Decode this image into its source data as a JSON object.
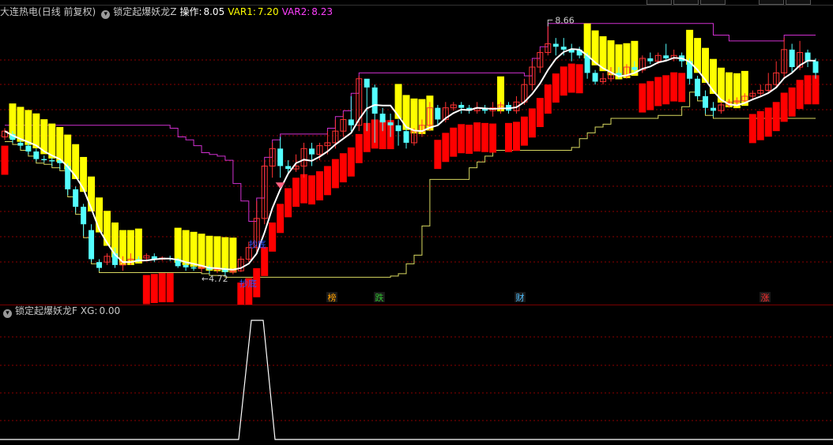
{
  "main_header": {
    "stock_name": "大连热电",
    "period": "(日线 前复权)",
    "indicator_name": "锁定起爆妖龙Z",
    "op_label": "操作:",
    "op_value": "8.05",
    "var1_label": "VAR1:",
    "var1_value": "7.20",
    "var2_label": "VAR2:",
    "var2_value": "8.23"
  },
  "sub_header": {
    "indicator_name": "锁定起爆妖龙F",
    "xg_label": "XG:",
    "xg_value": "0.00"
  },
  "colors": {
    "background": "#000000",
    "up_candle": "#ff3232",
    "down_candle": "#54ffff",
    "yellow_band": "#ffff00",
    "red_band": "#ff0000",
    "ma_line": "#ffffff",
    "upper_line": "#d030d0",
    "lower_line": "#d8d860",
    "title_text": "#c8c8c8",
    "op_color": "#ffffff",
    "var1_color": "#ffff00",
    "var2_color": "#ff40ff",
    "dotted_grid": "#8b0000"
  },
  "annotations": {
    "high_price": "8.66",
    "low_price": "4.72",
    "chaodi_label": "抄底",
    "bottom_markers": [
      {
        "text": "榜",
        "color": "#ffa000"
      },
      {
        "text": "跌",
        "color": "#30c030"
      },
      {
        "text": "财",
        "color": "#50c0ff"
      },
      {
        "text": "涨",
        "color": "#ff3030"
      }
    ]
  },
  "chart_data": {
    "type": "candlestick",
    "candles": [
      [
        7.1,
        7.2,
        7.25,
        7.05
      ],
      [
        7.15,
        7.05,
        7.2,
        7.0
      ],
      [
        7.0,
        6.95,
        7.05,
        6.9
      ],
      [
        6.95,
        6.85,
        7.0,
        6.8
      ],
      [
        6.85,
        6.72,
        6.9,
        6.68
      ],
      [
        6.72,
        6.7,
        6.78,
        6.66
      ],
      [
        6.7,
        6.68,
        6.75,
        6.6
      ],
      [
        6.7,
        6.65,
        6.72,
        6.55
      ],
      [
        6.6,
        6.2,
        6.65,
        6.1
      ],
      [
        6.2,
        5.9,
        6.25,
        5.8
      ],
      [
        5.9,
        5.6,
        5.95,
        5.4
      ],
      [
        5.5,
        5.0,
        5.6,
        4.95
      ],
      [
        4.95,
        4.85,
        5.0,
        4.8
      ],
      [
        4.95,
        5.05,
        5.1,
        4.9
      ],
      [
        5.1,
        4.9,
        5.2,
        4.85
      ],
      [
        4.9,
        4.95,
        5.05,
        4.8
      ],
      [
        4.95,
        5.0,
        5.1,
        4.9
      ],
      [
        5.0,
        4.98,
        5.05,
        4.95
      ],
      [
        5.02,
        5.06,
        5.1,
        4.98
      ],
      [
        5.05,
        4.99,
        5.1,
        4.95
      ],
      [
        5.0,
        5.02,
        5.05,
        4.97
      ],
      [
        5.02,
        5.0,
        5.06,
        4.97
      ],
      [
        5.0,
        4.88,
        5.02,
        4.85
      ],
      [
        4.9,
        4.86,
        4.95,
        4.8
      ],
      [
        4.86,
        4.84,
        4.9,
        4.8
      ],
      [
        4.84,
        4.86,
        4.9,
        4.78
      ],
      [
        4.86,
        4.82,
        4.9,
        4.75
      ],
      [
        4.82,
        4.84,
        4.86,
        4.76
      ],
      [
        4.84,
        4.78,
        4.86,
        4.72
      ],
      [
        4.78,
        4.8,
        4.84,
        4.74
      ],
      [
        4.8,
        5.0,
        5.05,
        4.78
      ],
      [
        5.0,
        5.2,
        5.3,
        4.95
      ],
      [
        5.2,
        5.7,
        6.0,
        5.1
      ],
      [
        5.7,
        6.6,
        6.7,
        5.6
      ],
      [
        6.6,
        6.9,
        7.0,
        6.4
      ],
      [
        6.9,
        6.6,
        7.1,
        6.4
      ],
      [
        6.6,
        6.55,
        6.7,
        6.45
      ],
      [
        6.55,
        6.6,
        6.8,
        6.5
      ],
      [
        6.6,
        6.9,
        7.0,
        6.4
      ],
      [
        6.9,
        6.8,
        7.0,
        6.6
      ],
      [
        6.8,
        6.95,
        7.0,
        6.7
      ],
      [
        6.95,
        7.0,
        7.2,
        6.8
      ],
      [
        7.0,
        7.2,
        7.4,
        6.9
      ],
      [
        7.2,
        7.4,
        7.5,
        7.1
      ],
      [
        7.4,
        7.3,
        7.8,
        7.2
      ],
      [
        7.3,
        8.1,
        8.15,
        7.2
      ],
      [
        8.1,
        7.95,
        8.0,
        7.2
      ],
      [
        7.95,
        7.5,
        8.0,
        7.0
      ],
      [
        7.5,
        7.35,
        7.6,
        7.2
      ],
      [
        7.35,
        7.3,
        7.5,
        7.1
      ],
      [
        7.3,
        7.2,
        7.4,
        6.95
      ],
      [
        7.2,
        7.0,
        7.3,
        6.9
      ],
      [
        7.0,
        7.2,
        7.25,
        6.95
      ],
      [
        7.2,
        7.3,
        7.4,
        7.1
      ],
      [
        7.3,
        7.6,
        7.7,
        7.2
      ],
      [
        7.6,
        7.4,
        7.65,
        7.3
      ],
      [
        7.4,
        7.6,
        7.7,
        7.35
      ],
      [
        7.6,
        7.65,
        7.7,
        7.55
      ],
      [
        7.65,
        7.6,
        7.7,
        7.5
      ],
      [
        7.6,
        7.55,
        7.65,
        7.5
      ],
      [
        7.55,
        7.6,
        7.7,
        7.5
      ],
      [
        7.6,
        7.55,
        7.65,
        7.5
      ],
      [
        7.55,
        7.6,
        7.7,
        7.45
      ],
      [
        7.6,
        7.65,
        7.7,
        7.5
      ],
      [
        7.65,
        7.55,
        7.7,
        7.5
      ],
      [
        7.55,
        7.7,
        7.8,
        7.5
      ],
      [
        7.7,
        8.0,
        8.1,
        7.65
      ],
      [
        8.0,
        8.3,
        8.4,
        7.9
      ],
      [
        8.3,
        8.55,
        8.6,
        8.2
      ],
      [
        8.55,
        8.7,
        9.0,
        8.5
      ],
      [
        8.7,
        8.65,
        8.8,
        8.5
      ],
      [
        8.65,
        8.6,
        8.8,
        8.5
      ],
      [
        8.6,
        8.55,
        8.7,
        8.4
      ],
      [
        8.6,
        8.5,
        8.65,
        8.45
      ],
      [
        8.5,
        8.2,
        8.55,
        8.1
      ],
      [
        8.2,
        8.05,
        8.25,
        8.0
      ],
      [
        8.05,
        8.1,
        8.2,
        8.0
      ],
      [
        8.1,
        8.2,
        8.3,
        8.05
      ],
      [
        8.2,
        8.15,
        8.3,
        8.1
      ],
      [
        8.15,
        8.3,
        8.35,
        8.1
      ],
      [
        8.3,
        8.25,
        8.4,
        8.2
      ],
      [
        8.25,
        8.45,
        8.5,
        8.2
      ],
      [
        8.45,
        8.4,
        8.55,
        8.35
      ],
      [
        8.4,
        8.5,
        8.55,
        8.35
      ],
      [
        8.5,
        8.45,
        8.7,
        8.4
      ],
      [
        8.45,
        8.5,
        8.6,
        8.4
      ],
      [
        8.5,
        8.4,
        8.55,
        8.3
      ],
      [
        8.4,
        8.1,
        8.45,
        8.0
      ],
      [
        8.1,
        7.8,
        8.15,
        7.75
      ],
      [
        7.8,
        7.6,
        7.9,
        7.5
      ],
      [
        7.6,
        7.55,
        7.7,
        7.45
      ],
      [
        7.55,
        7.65,
        7.7,
        7.5
      ],
      [
        7.65,
        7.7,
        7.75,
        7.6
      ],
      [
        7.7,
        7.72,
        7.78,
        7.65
      ],
      [
        7.72,
        7.8,
        7.85,
        7.7
      ],
      [
        7.8,
        7.85,
        7.9,
        7.75
      ],
      [
        7.85,
        7.9,
        8.0,
        7.8
      ],
      [
        7.9,
        8.0,
        8.2,
        7.85
      ],
      [
        8.0,
        8.2,
        8.4,
        7.95
      ],
      [
        8.2,
        8.6,
        8.8,
        8.1
      ],
      [
        8.6,
        8.3,
        8.7,
        8.2
      ],
      [
        8.3,
        8.55,
        8.75,
        8.25
      ],
      [
        8.55,
        8.4,
        8.6,
        8.3
      ],
      [
        8.4,
        8.2,
        8.45,
        8.1
      ]
    ]
  }
}
